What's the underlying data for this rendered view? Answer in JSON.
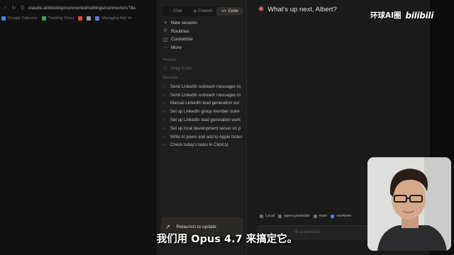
{
  "browser": {
    "url": "claude.ai/desktop/connected/settings/connectors?&s",
    "bookmarks": [
      {
        "label": "Google Calendar",
        "color": "#4285f4"
      },
      {
        "label": "Tracking Sheet",
        "color": "#34a853"
      },
      {
        "label": "",
        "color": "#ea4335"
      },
      {
        "label": "",
        "color": "#9aa0a6"
      },
      {
        "label": "Managing Ads Ye",
        "color": "#5b7bd6"
      }
    ]
  },
  "sidebar": {
    "modes": [
      {
        "label": "Chat",
        "icon": "chat-bubble-icon",
        "active": false
      },
      {
        "label": "Cowork",
        "icon": "cowork-icon",
        "active": false
      },
      {
        "label": "Code",
        "icon": "code-brackets-icon",
        "active": true
      }
    ],
    "nav": [
      {
        "label": "New session",
        "icon": "plus-icon",
        "glyph": "+"
      },
      {
        "label": "Routines",
        "icon": "routines-icon",
        "glyph": "⟐"
      },
      {
        "label": "Customize",
        "icon": "customize-icon",
        "glyph": "◫"
      },
      {
        "label": "More",
        "icon": "more-icon",
        "glyph": "⋯"
      }
    ],
    "pinned_label": "Pinned",
    "pinned_placeholder": "Drag to pin",
    "recents_label": "Recents",
    "recents": [
      "Send LinkedIn outreach messages to",
      "Send LinkedIn outreach messages to",
      "Manual LinkedIn lead generation out",
      "Set up LinkedIn group member outre",
      "Set up LinkedIn lead generation work",
      "Set up local development server on p",
      "Write AI poem and add to Apple Notes",
      "Check today's tasks in ClickUp"
    ],
    "relaunch_label": "Relaunch to update"
  },
  "main": {
    "greeting": "What's up next, Albert?",
    "chips": [
      {
        "label": "Local",
        "icon": "monitor-icon"
      },
      {
        "label": "agencywebsite",
        "icon": "folder-icon"
      },
      {
        "label": "main",
        "icon": "branch-icon"
      },
      {
        "label": "worktree",
        "icon": "worktree-icon"
      }
    ],
    "composer_placeholder": "sk a question"
  },
  "overlay": {
    "watermark_cn": "环球AI圈",
    "watermark_bili": "bilibili",
    "subtitle": "我们用 Opus 4.7 来搞定它。"
  },
  "colors": {
    "accent": "#d97757",
    "sidebar_bg": "#1e1e1d",
    "main_bg": "#1b1b1a"
  }
}
